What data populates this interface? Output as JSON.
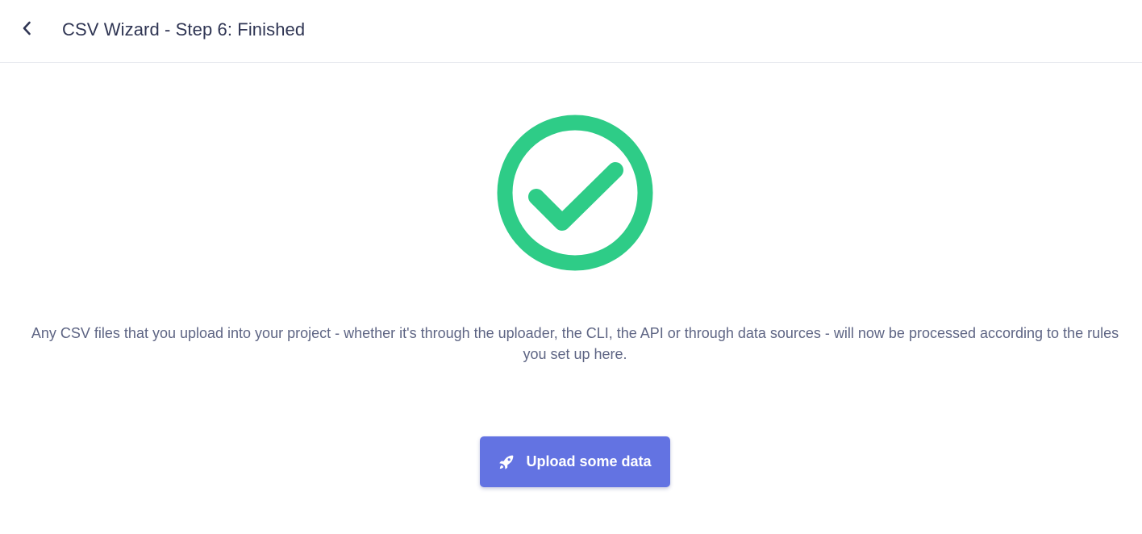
{
  "header": {
    "title": "CSV Wizard - Step 6: Finished",
    "back_icon": "chevron-left-icon"
  },
  "status": {
    "icon": "check-circle-icon",
    "color": "#2ecc87"
  },
  "message": {
    "text": "Any CSV files that you upload into your project - whether it's through the uploader, the CLI, the API or through data sources - will now be processed according to the rules you set up here."
  },
  "actions": {
    "upload_label": "Upload some data",
    "upload_icon": "rocket-icon",
    "upload_color": "#6373e2"
  }
}
